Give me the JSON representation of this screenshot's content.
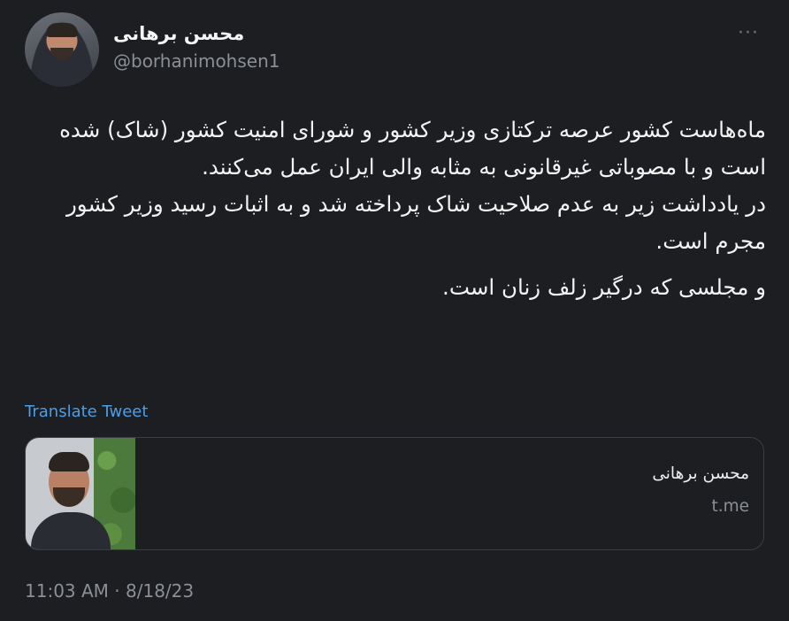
{
  "author": {
    "name": "محسن برهانی",
    "handle": "@borhanimohsen1"
  },
  "tweet": {
    "paragraphs": [
      "ماه‌هاست کشور عرصه ترکتازی وزیر کشور و شورای امنیت کشور (شاک) شده است و با مصوباتی غیرقانونی به مثابه والی ایران عمل می‌کنند.\nدر یادداشت زیر به عدم صلاحیت شاک پرداخته شد و به اثبات رسید وزیر کشور مجرم است.",
      "و مجلسی که درگیر زلف زنان است."
    ],
    "translate_label": "Translate Tweet",
    "timestamp": "11:03 AM · 8/18/23"
  },
  "card": {
    "title": "محسن برهانی",
    "domain": "t.me"
  },
  "icons": {
    "more": "more-horizontal-icon"
  },
  "colors": {
    "background": "#1d1e22",
    "link": "#4a9eea",
    "muted": "#8b8f96"
  }
}
